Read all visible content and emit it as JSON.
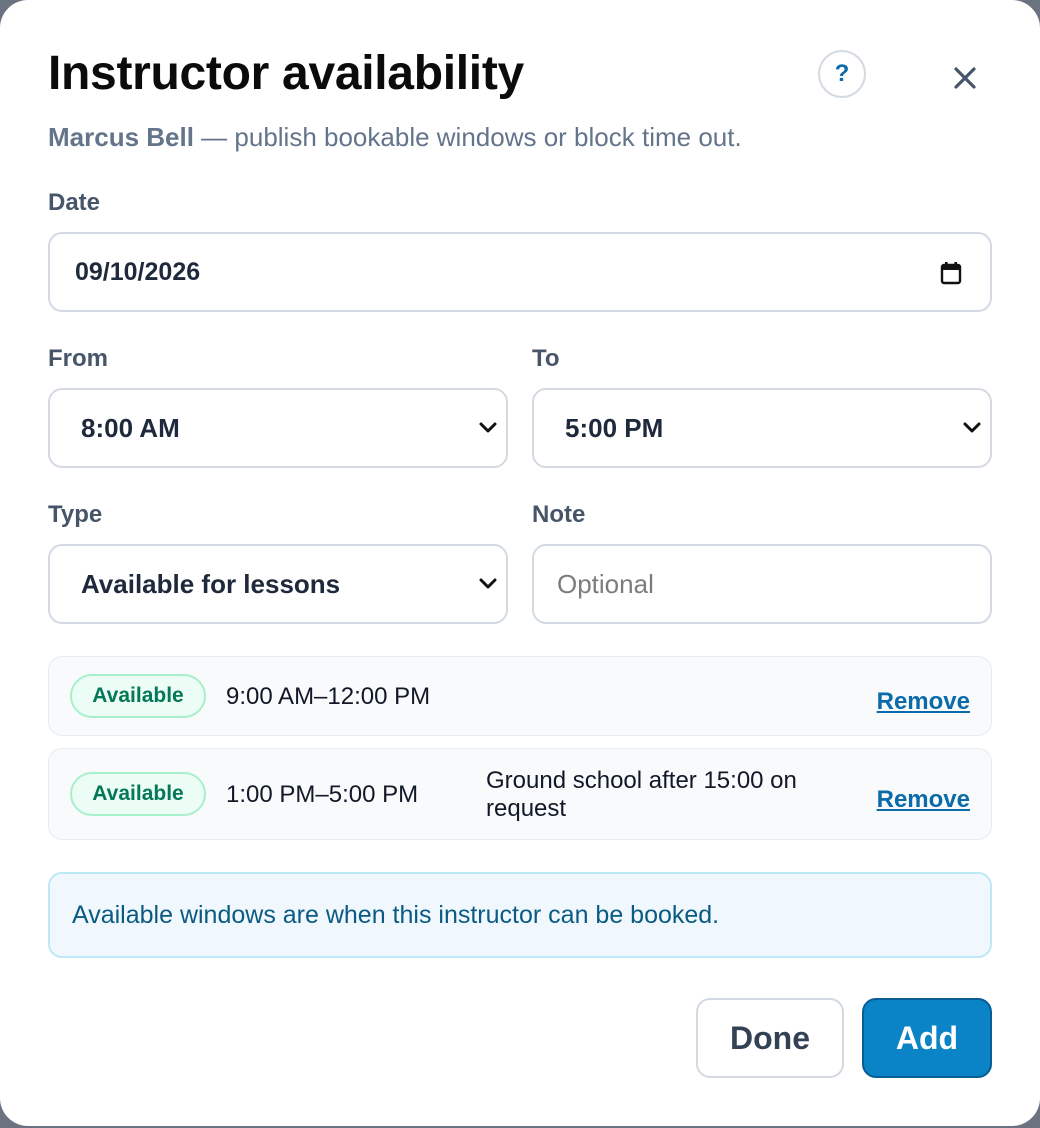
{
  "dialog": {
    "title": "Instructor availability",
    "help_label": "?",
    "instructor_name": "Marcus Bell",
    "subtitle_rest": " — publish bookable windows or block time out."
  },
  "form": {
    "date_label": "Date",
    "date_value": "09/10/2026",
    "from_label": "From",
    "from_value": "8:00 AM",
    "to_label": "To",
    "to_value": "5:00 PM",
    "type_label": "Type",
    "type_value": "Available for lessons",
    "note_label": "Note",
    "note_placeholder": "Optional"
  },
  "slots": [
    {
      "badge": "Available",
      "time": "9:00 AM–12:00 PM",
      "note": "",
      "remove_label": "Remove"
    },
    {
      "badge": "Available",
      "time": "1:00 PM–5:00 PM",
      "note": "Ground school after 15:00 on request",
      "remove_label": "Remove"
    }
  ],
  "info_text": "Available windows are when this instructor can be booked.",
  "actions": {
    "done_label": "Done",
    "add_label": "Add"
  },
  "colors": {
    "accent": "#0a84c6",
    "badge_available": "#047857",
    "info_text": "#0b5a82"
  },
  "icons": {
    "close": "close-icon",
    "calendar": "calendar-icon",
    "dropdown": "chevron-down-icon",
    "help": "help-icon"
  }
}
